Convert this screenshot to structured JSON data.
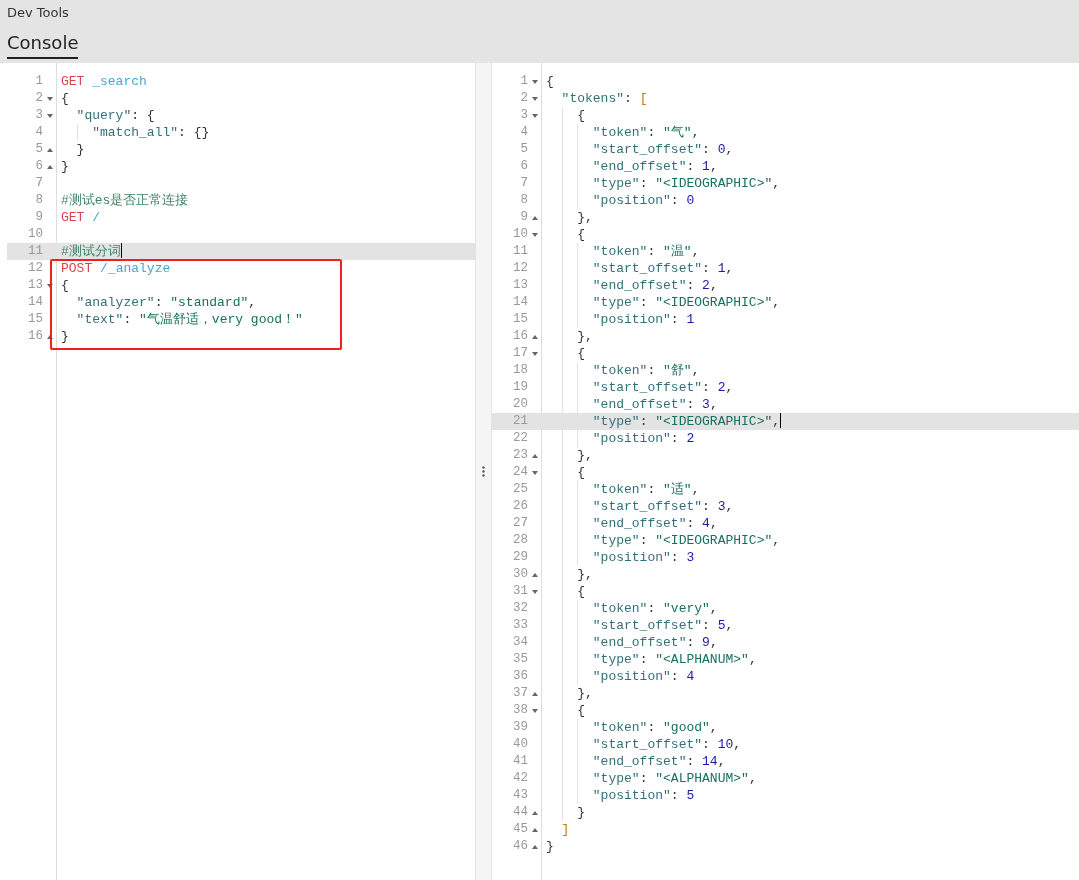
{
  "app_title": "Dev Tools",
  "tabs": [
    {
      "label": "Console",
      "selected": true
    }
  ],
  "request_editor": {
    "lines": [
      {
        "number": "1",
        "highlighted": false,
        "text": "GET _search"
      },
      {
        "number": "2",
        "highlighted": false,
        "fold_marker": {
          "kind": "open"
        },
        "text": "{"
      },
      {
        "number": "3",
        "highlighted": false,
        "fold_marker": {
          "kind": "open"
        },
        "text": "  \"query\": {"
      },
      {
        "number": "4",
        "highlighted": false,
        "text": "    \"match_all\": {}"
      },
      {
        "number": "5",
        "highlighted": false,
        "fold_marker": {
          "kind": "close"
        },
        "text": "  }"
      },
      {
        "number": "6",
        "highlighted": false,
        "fold_marker": {
          "kind": "close"
        },
        "text": "}"
      },
      {
        "number": "7",
        "highlighted": false
      },
      {
        "number": "8",
        "highlighted": false,
        "text": "#测试es是否正常连接"
      },
      {
        "number": "9",
        "highlighted": false,
        "text": "GET /"
      },
      {
        "number": "10",
        "highlighted": false
      },
      {
        "number": "11",
        "highlighted": true,
        "text": "#测试分词"
      }
    ],
    "boxed_lines": [
      {
        "number": "12",
        "highlighted": false,
        "text": "POST /_analyze"
      },
      {
        "number": "13",
        "highlighted": false,
        "fold_marker": {
          "kind": "open"
        },
        "text": "{"
      },
      {
        "number": "14",
        "highlighted": false,
        "text": "  \"analyzer\": \"standard\","
      },
      {
        "number": "15",
        "highlighted": false,
        "text": "  \"text\": \"气温舒适，very good！\""
      },
      {
        "number": "16",
        "highlighted": false,
        "fold_marker": {
          "kind": "close"
        },
        "text": "}"
      }
    ]
  },
  "response_editor": {
    "lines": [
      {
        "number": "1",
        "highlighted": false,
        "fold_marker": {
          "kind": "open"
        },
        "text": "{"
      },
      {
        "number": "2",
        "highlighted": false,
        "fold_marker": {
          "kind": "open"
        },
        "text": "  \"tokens\": ["
      },
      {
        "number": "3",
        "highlighted": false,
        "fold_marker": {
          "kind": "open"
        },
        "text": "    {"
      },
      {
        "number": "4",
        "highlighted": false,
        "text": "      \"token\": \"气\","
      },
      {
        "number": "5",
        "highlighted": false,
        "text": "      \"start_offset\": 0,"
      },
      {
        "number": "6",
        "highlighted": false,
        "text": "      \"end_offset\": 1,"
      },
      {
        "number": "7",
        "highlighted": false,
        "text": "      \"type\": \"<IDEOGRAPHIC>\","
      },
      {
        "number": "8",
        "highlighted": false,
        "text": "      \"position\": 0"
      },
      {
        "number": "9",
        "highlighted": false,
        "fold_marker": {
          "kind": "close"
        },
        "text": "    },"
      },
      {
        "number": "10",
        "highlighted": false,
        "fold_marker": {
          "kind": "open"
        },
        "text": "    {"
      },
      {
        "number": "11",
        "highlighted": false,
        "text": "      \"token\": \"温\","
      },
      {
        "number": "12",
        "highlighted": false,
        "text": "      \"start_offset\": 1,"
      },
      {
        "number": "13",
        "highlighted": false,
        "text": "      \"end_offset\": 2,"
      },
      {
        "number": "14",
        "highlighted": false,
        "text": "      \"type\": \"<IDEOGRAPHIC>\","
      },
      {
        "number": "15",
        "highlighted": false,
        "text": "      \"position\": 1"
      },
      {
        "number": "16",
        "highlighted": false,
        "fold_marker": {
          "kind": "close"
        },
        "text": "    },"
      },
      {
        "number": "17",
        "highlighted": false,
        "fold_marker": {
          "kind": "open"
        },
        "text": "    {"
      },
      {
        "number": "18",
        "highlighted": false,
        "text": "      \"token\": \"舒\","
      },
      {
        "number": "19",
        "highlighted": false,
        "text": "      \"start_offset\": 2,"
      },
      {
        "number": "20",
        "highlighted": false,
        "text": "      \"end_offset\": 3,"
      },
      {
        "number": "21",
        "highlighted": true,
        "text": "      \"type\": \"<IDEOGRAPHIC>\","
      },
      {
        "number": "22",
        "highlighted": false,
        "text": "      \"position\": 2"
      },
      {
        "number": "23",
        "highlighted": false,
        "fold_marker": {
          "kind": "close"
        },
        "text": "    },"
      },
      {
        "number": "24",
        "highlighted": false,
        "fold_marker": {
          "kind": "open"
        },
        "text": "    {"
      },
      {
        "number": "25",
        "highlighted": false,
        "text": "      \"token\": \"适\","
      },
      {
        "number": "26",
        "highlighted": false,
        "text": "      \"start_offset\": 3,"
      },
      {
        "number": "27",
        "highlighted": false,
        "text": "      \"end_offset\": 4,"
      },
      {
        "number": "28",
        "highlighted": false,
        "text": "      \"type\": \"<IDEOGRAPHIC>\","
      },
      {
        "number": "29",
        "highlighted": false,
        "text": "      \"position\": 3"
      },
      {
        "number": "30",
        "highlighted": false,
        "fold_marker": {
          "kind": "close"
        },
        "text": "    },"
      },
      {
        "number": "31",
        "highlighted": false,
        "fold_marker": {
          "kind": "open"
        },
        "text": "    {"
      },
      {
        "number": "32",
        "highlighted": false,
        "text": "      \"token\": \"very\","
      },
      {
        "number": "33",
        "highlighted": false,
        "text": "      \"start_offset\": 5,"
      },
      {
        "number": "34",
        "highlighted": false,
        "text": "      \"end_offset\": 9,"
      },
      {
        "number": "35",
        "highlighted": false,
        "text": "      \"type\": \"<ALPHANUM>\","
      },
      {
        "number": "36",
        "highlighted": false,
        "text": "      \"position\": 4"
      },
      {
        "number": "37",
        "highlighted": false,
        "fold_marker": {
          "kind": "close"
        },
        "text": "    },"
      },
      {
        "number": "38",
        "highlighted": false,
        "fold_marker": {
          "kind": "open"
        },
        "text": "    {"
      },
      {
        "number": "39",
        "highlighted": false,
        "text": "      \"token\": \"good\","
      },
      {
        "number": "40",
        "highlighted": false,
        "text": "      \"start_offset\": 10,"
      },
      {
        "number": "41",
        "highlighted": false,
        "text": "      \"end_offset\": 14,"
      },
      {
        "number": "42",
        "highlighted": false,
        "text": "      \"type\": \"<ALPHANUM>\","
      },
      {
        "number": "43",
        "highlighted": false,
        "text": "      \"position\": 5"
      },
      {
        "number": "44",
        "highlighted": false,
        "fold_marker": {
          "kind": "close"
        },
        "text": "    }"
      },
      {
        "number": "45",
        "highlighted": false,
        "fold_marker": {
          "kind": "close"
        },
        "text": "  ]"
      },
      {
        "number": "46",
        "highlighted": false,
        "fold_marker": {
          "kind": "close"
        },
        "text": "}"
      }
    ]
  }
}
